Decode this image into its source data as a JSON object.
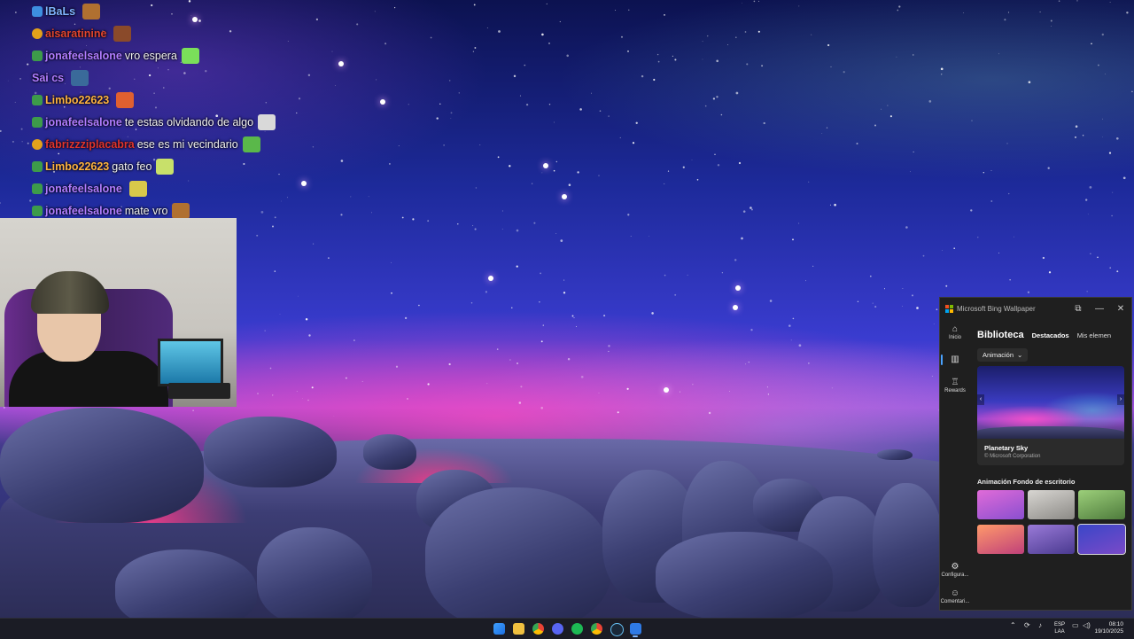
{
  "chat": {
    "messages": [
      {
        "user": "lBaLs",
        "user_color": "#7fb3ff",
        "text": "",
        "badge": "blue"
      },
      {
        "user": "aisaratinine",
        "user_color": "#e0442e",
        "text": "",
        "badge": "gold"
      },
      {
        "user": "jonafeelsalone",
        "user_color": "#b07cff",
        "text": "vro espera",
        "badge": "green"
      },
      {
        "user": "Sai cs",
        "user_color": "#b07cff",
        "text": "",
        "badge": "none"
      },
      {
        "user": "Limbo22623",
        "user_color": "#ffb340",
        "text": "",
        "badge": "green"
      },
      {
        "user": "jonafeelsalone",
        "user_color": "#b07cff",
        "text": "te estas olvidando de algo",
        "badge": "green"
      },
      {
        "user": "fabrizzziplacabra",
        "user_color": "#e0342e",
        "text": "ese es mi vecindario",
        "badge": "gold"
      },
      {
        "user": "Limbo22623",
        "user_color": "#ffb340",
        "text": "gato feo",
        "badge": "green"
      },
      {
        "user": "jonafeelsalone",
        "user_color": "#b07cff",
        "text": "",
        "badge": "green"
      },
      {
        "user": "jonafeelsalone",
        "user_color": "#b07cff",
        "text": "mate vro",
        "badge": "green"
      }
    ]
  },
  "bing_window": {
    "title": "Microsoft Bing Wallpaper",
    "nav": {
      "home": "Inicio",
      "rewards": "Rewards",
      "settings": "Configura...",
      "feedback": "Comentari..."
    },
    "heading": "Biblioteca",
    "tabs": [
      "Destacados",
      "Mis elemen"
    ],
    "filter_label": "Animación",
    "featured": {
      "title": "Planetary Sky",
      "credit": "© Microsoft Corporation"
    },
    "section_title": "Animación Fondo de escritorio",
    "thumbnails": [
      {
        "name": "pink-fantasy",
        "colors": [
          "#e06bd8",
          "#8a4fd0"
        ]
      },
      {
        "name": "cloud-temple",
        "colors": [
          "#d8d6d2",
          "#8c8a86"
        ]
      },
      {
        "name": "green-arch",
        "colors": [
          "#9ccf7a",
          "#4e7b3c"
        ]
      },
      {
        "name": "sunset-clouds",
        "colors": [
          "#ff9a6a",
          "#c0407a"
        ]
      },
      {
        "name": "purple-lake",
        "colors": [
          "#9a7ad8",
          "#4a3a90"
        ]
      },
      {
        "name": "planetary-sky",
        "colors": [
          "#3a46c8",
          "#7a4ac8"
        ]
      }
    ]
  },
  "taskbar": {
    "apps": [
      "start",
      "file-explorer",
      "chrome",
      "discord",
      "spotify",
      "chrome-alt",
      "steam",
      "bing-wallpaper"
    ],
    "lang": "ESP",
    "lang_sub": "LAA",
    "time": "08:10",
    "date": "19/10/2025"
  },
  "colors": {
    "accent": "#4aa3ff",
    "window_bg": "#1f1f1f",
    "taskbar_bg": "#1b1c25"
  }
}
